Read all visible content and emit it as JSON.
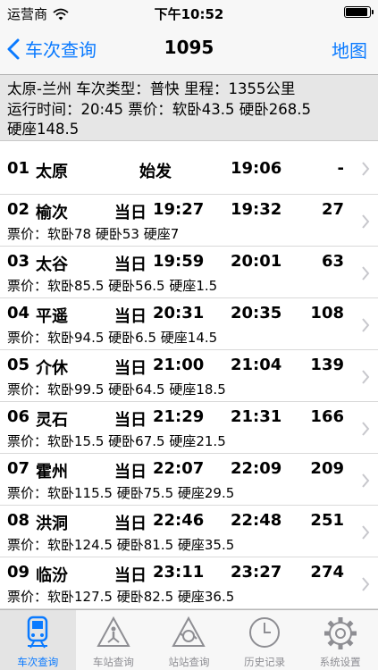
{
  "status": {
    "carrier": "运营商",
    "time": "下午10:52"
  },
  "nav": {
    "back_label": "车次查询",
    "title": "1095",
    "right_label": "地图"
  },
  "info": {
    "line1": "太原-兰州 车次类型：普快 里程：1355公里",
    "line2": "运行时间：20:45 票价：软卧43.5 硬卧268.5",
    "line3": "硬座148.5"
  },
  "stations": [
    {
      "index": "01",
      "name": "太原",
      "day": "",
      "arrive": "始发",
      "depart": "19:06",
      "km": "-",
      "price": ""
    },
    {
      "index": "02",
      "name": "榆次",
      "day": "当日",
      "arrive": "19:27",
      "depart": "19:32",
      "km": "27",
      "price": "票价：软卧78 硬卧53 硬座7"
    },
    {
      "index": "03",
      "name": "太谷",
      "day": "当日",
      "arrive": "19:59",
      "depart": "20:01",
      "km": "63",
      "price": "票价：软卧85.5 硬卧56.5 硬座1.5"
    },
    {
      "index": "04",
      "name": "平遥",
      "day": "当日",
      "arrive": "20:31",
      "depart": "20:35",
      "km": "108",
      "price": "票价：软卧94.5 硬卧6.5 硬座14.5"
    },
    {
      "index": "05",
      "name": "介休",
      "day": "当日",
      "arrive": "21:00",
      "depart": "21:04",
      "km": "139",
      "price": "票价：软卧99.5 硬卧64.5 硬座18.5"
    },
    {
      "index": "06",
      "name": "灵石",
      "day": "当日",
      "arrive": "21:29",
      "depart": "21:31",
      "km": "166",
      "price": "票价：软卧15.5 硬卧67.5 硬座21.5"
    },
    {
      "index": "07",
      "name": "霍州",
      "day": "当日",
      "arrive": "22:07",
      "depart": "22:09",
      "km": "209",
      "price": "票价：软卧115.5 硬卧75.5 硬座29.5"
    },
    {
      "index": "08",
      "name": "洪洞",
      "day": "当日",
      "arrive": "22:46",
      "depart": "22:48",
      "km": "251",
      "price": "票价：软卧124.5 硬卧81.5 硬座35.5"
    },
    {
      "index": "09",
      "name": "临汾",
      "day": "当日",
      "arrive": "23:11",
      "depart": "23:27",
      "km": "274",
      "price": "票价：软卧127.5 硬卧82.5 硬座36.5"
    }
  ],
  "tabs": [
    {
      "label": "车次查询",
      "icon": "train-icon",
      "active": true
    },
    {
      "label": "车站查询",
      "icon": "station-warning-icon",
      "active": false
    },
    {
      "label": "站站查询",
      "icon": "station-to-station-icon",
      "active": false
    },
    {
      "label": "历史记录",
      "icon": "clock-icon",
      "active": false
    },
    {
      "label": "系统设置",
      "icon": "gear-icon",
      "active": false
    }
  ],
  "colors": {
    "accent": "#0a7aff",
    "info_bg": "#e6e6e6",
    "tab_inactive": "#8e8e93"
  }
}
